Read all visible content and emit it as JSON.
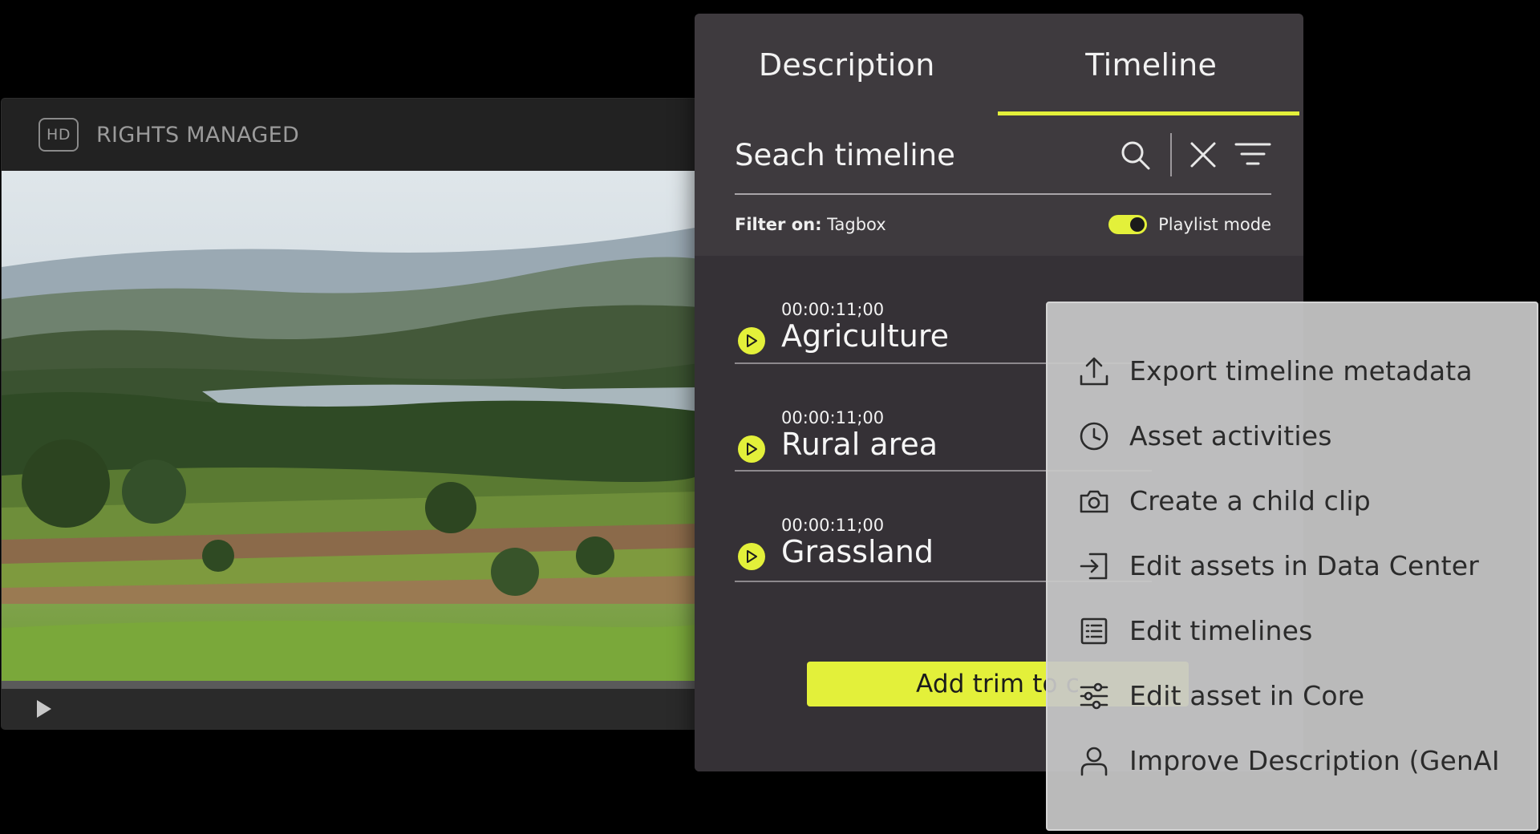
{
  "player": {
    "badge": "HD",
    "rights_label": "RIGHTS MANAGED",
    "play_icon": "play-icon"
  },
  "panel": {
    "tabs": [
      {
        "label": "Description",
        "active": false
      },
      {
        "label": "Timeline",
        "active": true
      }
    ],
    "search": {
      "placeholder": "Seach timeline",
      "value": ""
    },
    "filter": {
      "prefix": "Filter on:",
      "value": "Tagbox"
    },
    "playlist_mode": {
      "label": "Playlist mode",
      "enabled": true
    },
    "entries": [
      {
        "time": "00:00:11;00",
        "name": "Agriculture"
      },
      {
        "time": "00:00:11;00",
        "name": "Rural area"
      },
      {
        "time": "00:00:11;00",
        "name": "Grassland"
      }
    ],
    "add_trim_label": "Add trim to c"
  },
  "menu": {
    "items": [
      {
        "label": "Export timeline metadata",
        "icon": "export-icon"
      },
      {
        "label": "Asset activities",
        "icon": "clock-icon"
      },
      {
        "label": "Create a child clip",
        "icon": "camera-icon"
      },
      {
        "label": "Edit assets in Data Center",
        "icon": "sign-in-icon"
      },
      {
        "label": "Edit timelines",
        "icon": "list-icon"
      },
      {
        "label": "Edit asset in Core",
        "icon": "sliders-icon"
      },
      {
        "label": "Improve Description (GenAI",
        "icon": "user-icon"
      }
    ]
  },
  "colors": {
    "accent": "#e3f03a",
    "panel_bg": "#3e3a3e",
    "menu_bg": "#c8c8c8"
  }
}
